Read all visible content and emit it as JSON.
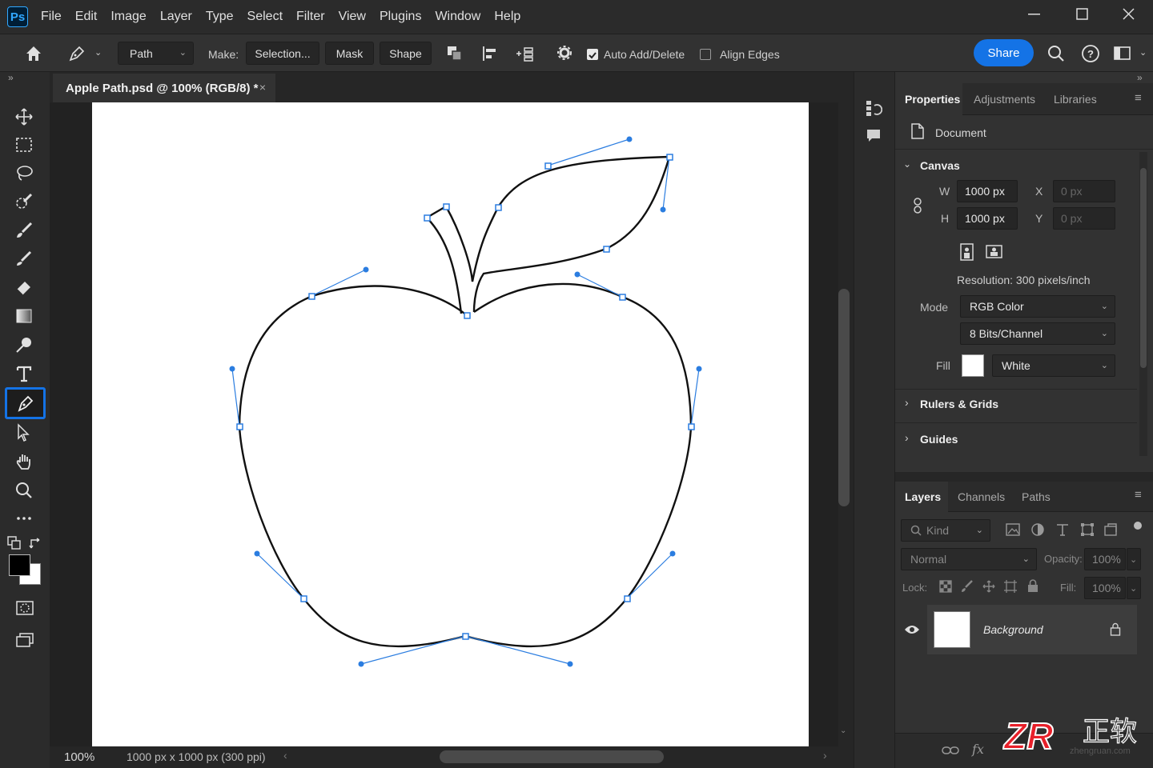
{
  "app": {
    "logo_text": "Ps"
  },
  "menu": [
    "File",
    "Edit",
    "Image",
    "Layer",
    "Type",
    "Select",
    "Filter",
    "View",
    "Plugins",
    "Window",
    "Help"
  ],
  "options": {
    "mode_value": "Path",
    "make_label": "Make:",
    "selection_btn": "Selection...",
    "mask_btn": "Mask",
    "shape_btn": "Shape",
    "auto_add_delete": "Auto Add/Delete",
    "align_edges": "Align Edges",
    "share": "Share"
  },
  "document": {
    "tab_title": "Apple Path.psd @ 100% (RGB/8) *",
    "zoom": "100%",
    "doc_info": "1000 px x 1000 px (300 ppi)"
  },
  "properties": {
    "tabs": [
      "Properties",
      "Adjustments",
      "Libraries"
    ],
    "header": "Document",
    "canvas_title": "Canvas",
    "w_label": "W",
    "w_value": "1000 px",
    "h_label": "H",
    "h_value": "1000 px",
    "x_label": "X",
    "x_value": "0 px",
    "y_label": "Y",
    "y_value": "0 px",
    "resolution": "Resolution: 300 pixels/inch",
    "mode_label": "Mode",
    "mode_value": "RGB Color",
    "depth_value": "8 Bits/Channel",
    "fill_label": "Fill",
    "fill_value": "White",
    "rulers_grids": "Rulers & Grids",
    "guides": "Guides"
  },
  "layers": {
    "tabs": [
      "Layers",
      "Channels",
      "Paths"
    ],
    "kind_label": "Kind",
    "blend_mode": "Normal",
    "opacity_label": "Opacity:",
    "opacity_value": "100%",
    "lock_label": "Lock:",
    "fill_label": "Fill:",
    "fill_value": "100%",
    "items": [
      {
        "name": "Background"
      }
    ]
  },
  "watermark": {
    "text1": "正软",
    "text2": "zhengruan.com",
    "logo": "ZR"
  },
  "colors": {
    "accent": "#1473e6",
    "path_blue": "#1f6fd6",
    "canvas": "#ffffff"
  }
}
